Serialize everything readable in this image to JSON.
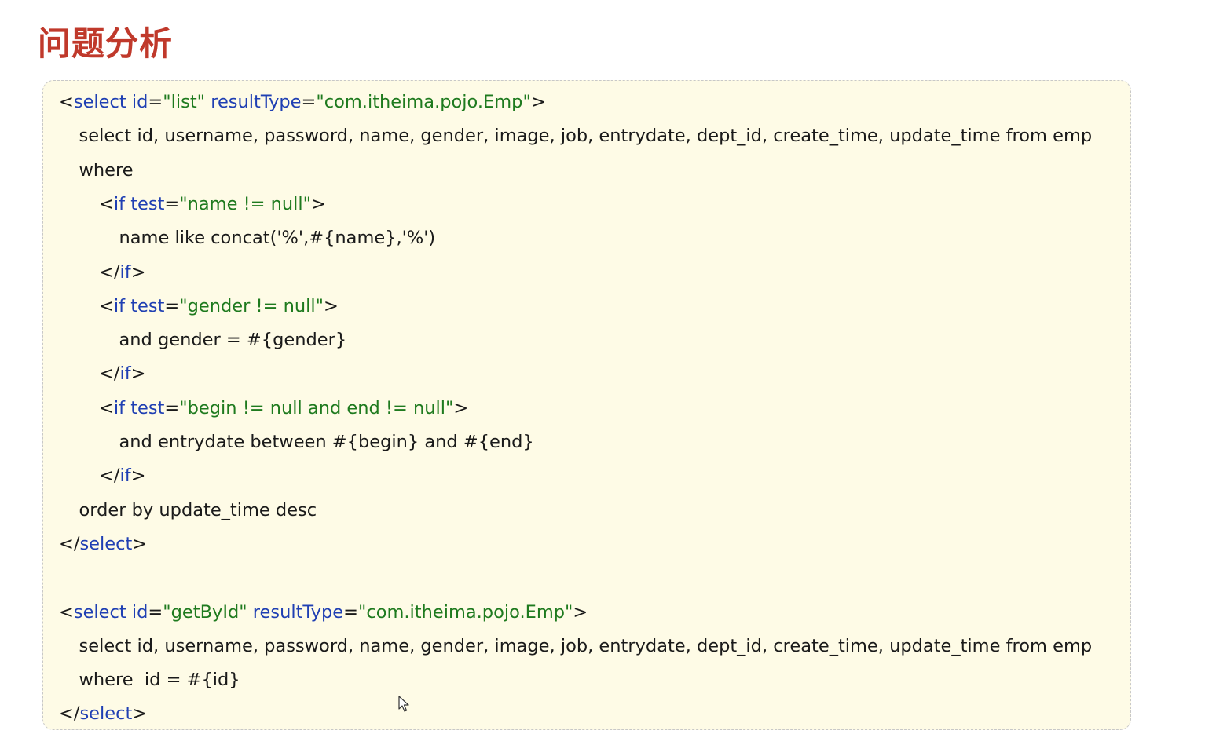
{
  "page": {
    "title": "问题分析"
  },
  "colors": {
    "title": "#c0392b",
    "plain": "#1a1a1a",
    "tag": "#1f3fb3",
    "attr": "#1f3fb3",
    "value": "#1e7a1e",
    "box_bg": "#fefbe6",
    "box_border": "#c8c8c8"
  },
  "code": {
    "lines": [
      {
        "indent": 0,
        "tokens": [
          {
            "t": "<",
            "c": "plain"
          },
          {
            "t": "select",
            "c": "tag"
          },
          {
            "t": " ",
            "c": "plain"
          },
          {
            "t": "id",
            "c": "attr"
          },
          {
            "t": "=",
            "c": "plain"
          },
          {
            "t": "\"list\"",
            "c": "value"
          },
          {
            "t": " ",
            "c": "plain"
          },
          {
            "t": "resultType",
            "c": "attr"
          },
          {
            "t": "=",
            "c": "plain"
          },
          {
            "t": "\"com.itheima.pojo.Emp\"",
            "c": "value"
          },
          {
            "t": ">",
            "c": "plain"
          }
        ]
      },
      {
        "indent": 1,
        "tokens": [
          {
            "t": "select id, username, password, name, gender, image, job, entrydate, dept_id, create_time, update_time from emp",
            "c": "plain"
          }
        ]
      },
      {
        "indent": 1,
        "tokens": [
          {
            "t": "where",
            "c": "plain"
          }
        ]
      },
      {
        "indent": 2,
        "tokens": [
          {
            "t": "<",
            "c": "plain"
          },
          {
            "t": "if",
            "c": "tag"
          },
          {
            "t": " ",
            "c": "plain"
          },
          {
            "t": "test",
            "c": "attr"
          },
          {
            "t": "=",
            "c": "plain"
          },
          {
            "t": "\"name != null\"",
            "c": "value"
          },
          {
            "t": ">",
            "c": "plain"
          }
        ]
      },
      {
        "indent": 3,
        "tokens": [
          {
            "t": "name like concat('%',#{name},'%')",
            "c": "plain"
          }
        ]
      },
      {
        "indent": 2,
        "tokens": [
          {
            "t": "</",
            "c": "plain"
          },
          {
            "t": "if",
            "c": "tag"
          },
          {
            "t": ">",
            "c": "plain"
          }
        ]
      },
      {
        "indent": 2,
        "tokens": [
          {
            "t": "<",
            "c": "plain"
          },
          {
            "t": "if",
            "c": "tag"
          },
          {
            "t": " ",
            "c": "plain"
          },
          {
            "t": "test",
            "c": "attr"
          },
          {
            "t": "=",
            "c": "plain"
          },
          {
            "t": "\"gender != null\"",
            "c": "value"
          },
          {
            "t": ">",
            "c": "plain"
          }
        ]
      },
      {
        "indent": 3,
        "tokens": [
          {
            "t": "and gender = #{gender}",
            "c": "plain"
          }
        ]
      },
      {
        "indent": 2,
        "tokens": [
          {
            "t": "</",
            "c": "plain"
          },
          {
            "t": "if",
            "c": "tag"
          },
          {
            "t": ">",
            "c": "plain"
          }
        ]
      },
      {
        "indent": 2,
        "tokens": [
          {
            "t": "<",
            "c": "plain"
          },
          {
            "t": "if",
            "c": "tag"
          },
          {
            "t": " ",
            "c": "plain"
          },
          {
            "t": "test",
            "c": "attr"
          },
          {
            "t": "=",
            "c": "plain"
          },
          {
            "t": "\"begin != null and end != null\"",
            "c": "value"
          },
          {
            "t": ">",
            "c": "plain"
          }
        ]
      },
      {
        "indent": 3,
        "tokens": [
          {
            "t": "and entrydate between #{begin} and #{end}",
            "c": "plain"
          }
        ]
      },
      {
        "indent": 2,
        "tokens": [
          {
            "t": "</",
            "c": "plain"
          },
          {
            "t": "if",
            "c": "tag"
          },
          {
            "t": ">",
            "c": "plain"
          }
        ]
      },
      {
        "indent": 1,
        "tokens": [
          {
            "t": "order by update_time desc",
            "c": "plain"
          }
        ]
      },
      {
        "indent": 0,
        "tokens": [
          {
            "t": "</",
            "c": "plain"
          },
          {
            "t": "select",
            "c": "tag"
          },
          {
            "t": ">",
            "c": "plain"
          }
        ]
      },
      {
        "indent": 0,
        "tokens": []
      },
      {
        "indent": 0,
        "tokens": [
          {
            "t": "<",
            "c": "plain"
          },
          {
            "t": "select",
            "c": "tag"
          },
          {
            "t": " ",
            "c": "plain"
          },
          {
            "t": "id",
            "c": "attr"
          },
          {
            "t": "=",
            "c": "plain"
          },
          {
            "t": "\"getById\"",
            "c": "value"
          },
          {
            "t": " ",
            "c": "plain"
          },
          {
            "t": "resultType",
            "c": "attr"
          },
          {
            "t": "=",
            "c": "plain"
          },
          {
            "t": "\"com.itheima.pojo.Emp\"",
            "c": "value"
          },
          {
            "t": ">",
            "c": "plain"
          }
        ]
      },
      {
        "indent": 1,
        "tokens": [
          {
            "t": "select id, username, password, name, gender, image, job, entrydate, dept_id, create_time, update_time from emp",
            "c": "plain"
          }
        ]
      },
      {
        "indent": 1,
        "tokens": [
          {
            "t": "where  id = #{id}",
            "c": "plain"
          }
        ]
      },
      {
        "indent": 0,
        "tokens": [
          {
            "t": "</",
            "c": "plain"
          },
          {
            "t": "select",
            "c": "tag"
          },
          {
            "t": ">",
            "c": "plain"
          }
        ]
      }
    ]
  },
  "cursor": {
    "icon": "mouse-pointer-icon"
  }
}
